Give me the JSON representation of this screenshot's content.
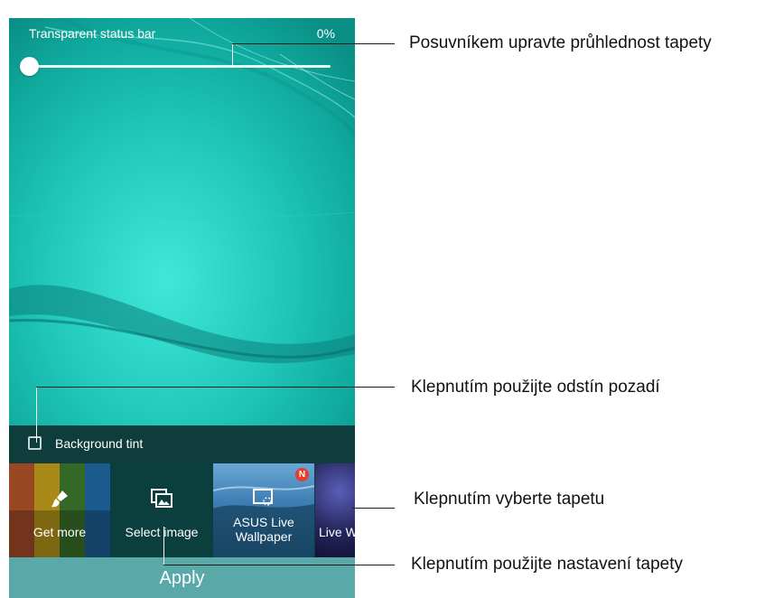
{
  "status": {
    "label": "Transparent status bar",
    "percent": "0%",
    "slider_value_percent": 0
  },
  "tint": {
    "label": "Background tint",
    "checked": false
  },
  "tiles": [
    {
      "label": "Get more",
      "icon": "paintbrush-icon"
    },
    {
      "label": "Select image",
      "icon": "gallery-icon"
    },
    {
      "label_line1": "ASUS Live",
      "label_line2": "Wallpaper",
      "icon": "live-wallpaper-icon",
      "badge": "N"
    },
    {
      "label": "Live W",
      "icon": ""
    }
  ],
  "apply": {
    "label": "Apply"
  },
  "callouts": [
    {
      "text": "Posuvníkem upravte průhlednost tapety"
    },
    {
      "text": "Klepnutím použijte odstín pozadí"
    },
    {
      "text": "Klepnutím vyberte tapetu"
    },
    {
      "text": "Klepnutím použijte nastavení tapety"
    }
  ],
  "colors": {
    "wallpaper": "#21c9bb",
    "tint_bar": "#0f3d3b",
    "apply_bar": "#58a9a8",
    "badge": "#e63d2f"
  }
}
